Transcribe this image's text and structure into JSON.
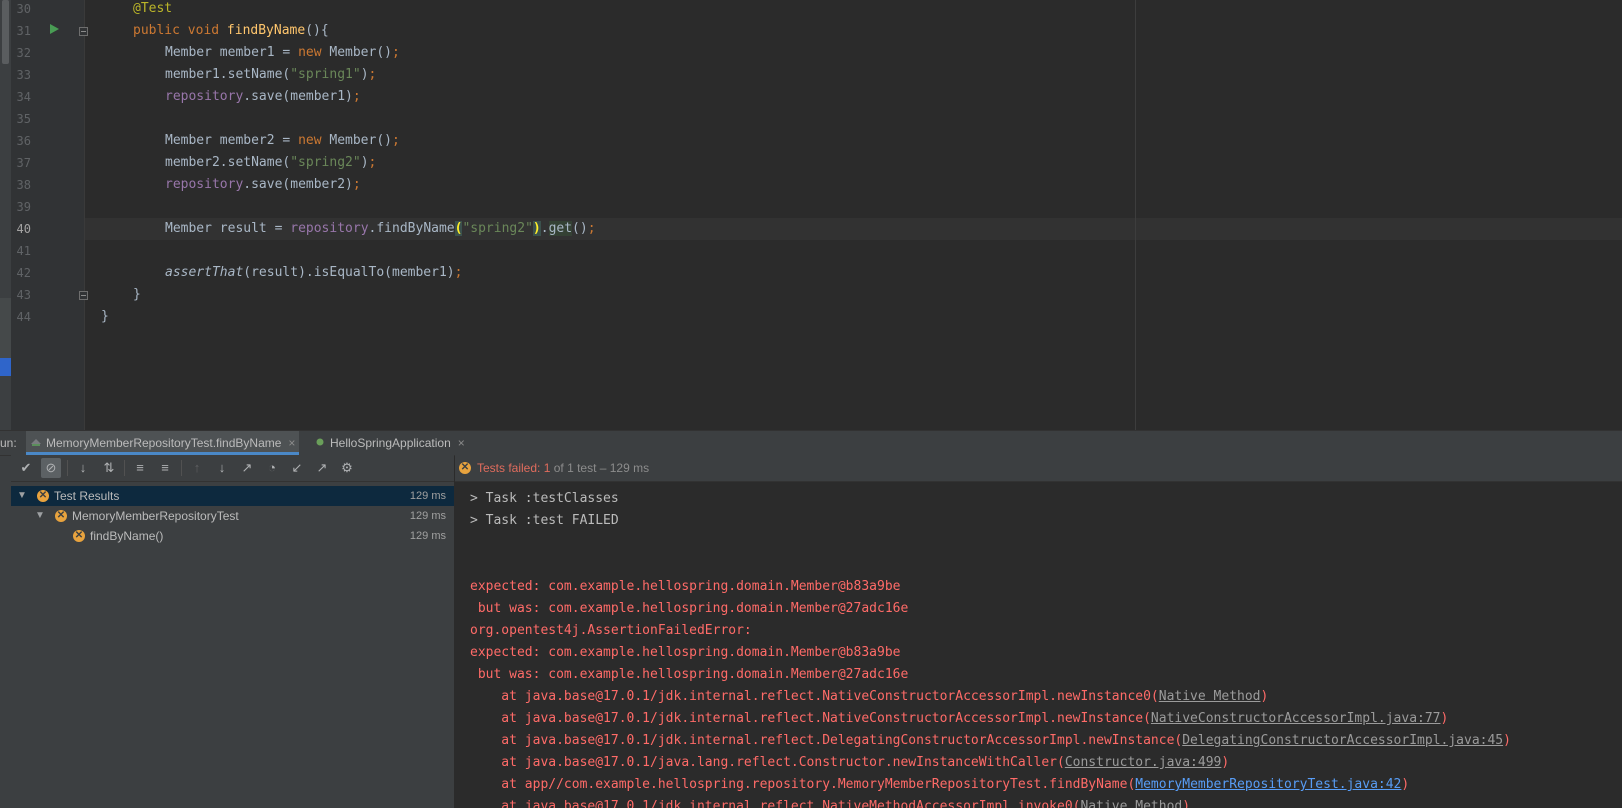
{
  "colors": {
    "editor_bg": "#2b2b2b",
    "panel_bg": "#3c3f41",
    "keyword": "#cc7832",
    "string": "#6a8759",
    "method": "#ffc66d",
    "field": "#9876aa",
    "error_text": "#ff6b68",
    "fail_icon": "#e8a33e",
    "link_blue": "#589df6"
  },
  "editor": {
    "line_numbers": [
      "30",
      "31",
      "32",
      "33",
      "34",
      "35",
      "36",
      "37",
      "38",
      "39",
      "40",
      "41",
      "42",
      "43",
      "44"
    ],
    "tokens": {
      "annotation": "@Test",
      "public_void": "public void ",
      "method_name": "findByName",
      "method_open": "(){",
      "member_type": "Member",
      "member1_decl": " member1 = ",
      "member2_decl": " member2 = ",
      "new_kw": "new",
      "ctor_call": " Member()",
      "semi": ";",
      "member1_setname": "member1.setName(",
      "member2_setname": "member2.setName(",
      "spring1": "\"spring1\"",
      "spring2": "\"spring2\"",
      "close_paren": ")",
      "repository": "repository",
      "save_member1": ".save(member1)",
      "save_member2": ".save(member2)",
      "result_decl": " result = ",
      "find_by_name_call": ".findByName",
      "open_paren": "(",
      "dot": ".",
      "get": "get",
      "get_tail": "()",
      "assert_that": "assertThat",
      "assert_tail": "(result).isEqualTo(member1)",
      "close_brace": "}"
    }
  },
  "run_panel": {
    "label": "un:",
    "tabs": [
      {
        "label": "MemoryMemberRepositoryTest.findByName",
        "close": "×"
      },
      {
        "label": "HelloSpringApplication",
        "close": "×"
      }
    ],
    "toolbar_icons": [
      "✔",
      "⊘",
      "↓",
      "⇅",
      "≡",
      "≡",
      "↑",
      "↓",
      "↗",
      "◔",
      "↙",
      "↗",
      "⚙"
    ],
    "status": {
      "prefix": "Tests failed: ",
      "failed_count": "1",
      "suffix": " of 1 test – 129 ms"
    },
    "tree": [
      {
        "label": "Test Results",
        "duration": "129 ms",
        "chevron": "▼"
      },
      {
        "label": "MemoryMemberRepositoryTest",
        "duration": "129 ms",
        "chevron": "▼"
      },
      {
        "label": "findByName()",
        "duration": "129 ms"
      }
    ],
    "fail_glyph": "✕",
    "console": {
      "line1": "> Task :testClasses",
      "line2": "> Task :test FAILED",
      "line3": "expected: com.example.hellospring.domain.Member@b83a9be",
      "line4": " but was: com.example.hellospring.domain.Member@27adc16e",
      "line5": "org.opentest4j.AssertionFailedError: ",
      "line6": "expected: com.example.hellospring.domain.Member@b83a9be",
      "line7": " but was: com.example.hellospring.domain.Member@27adc16e",
      "line8_a": "    at java.base@17.0.1/jdk.internal.reflect.NativeConstructorAccessorImpl.newInstance0(",
      "line8_link": "Native Method",
      "line8_b": ")",
      "line9_a": "    at java.base@17.0.1/jdk.internal.reflect.NativeConstructorAccessorImpl.newInstance(",
      "line9_link": "NativeConstructorAccessorImpl.java:77",
      "line9_b": ")",
      "line10_a": "    at java.base@17.0.1/jdk.internal.reflect.DelegatingConstructorAccessorImpl.newInstance(",
      "line10_link": "DelegatingConstructorAccessorImpl.java:45",
      "line10_b": ")",
      "line11_a": "    at java.base@17.0.1/java.lang.reflect.Constructor.newInstanceWithCaller(",
      "line11_link": "Constructor.java:499",
      "line11_b": ")",
      "line12_a": "    at app//com.example.hellospring.repository.MemoryMemberRepositoryTest.findByName(",
      "line12_link": "MemoryMemberRepositoryTest.java:42",
      "line12_b": ")",
      "line13_a": "    at java.base@17.0.1/jdk.internal.reflect.NativeMethodAccessorImpl.invoke0(",
      "line13_link": "Native Method",
      "line13_b": ")"
    }
  }
}
